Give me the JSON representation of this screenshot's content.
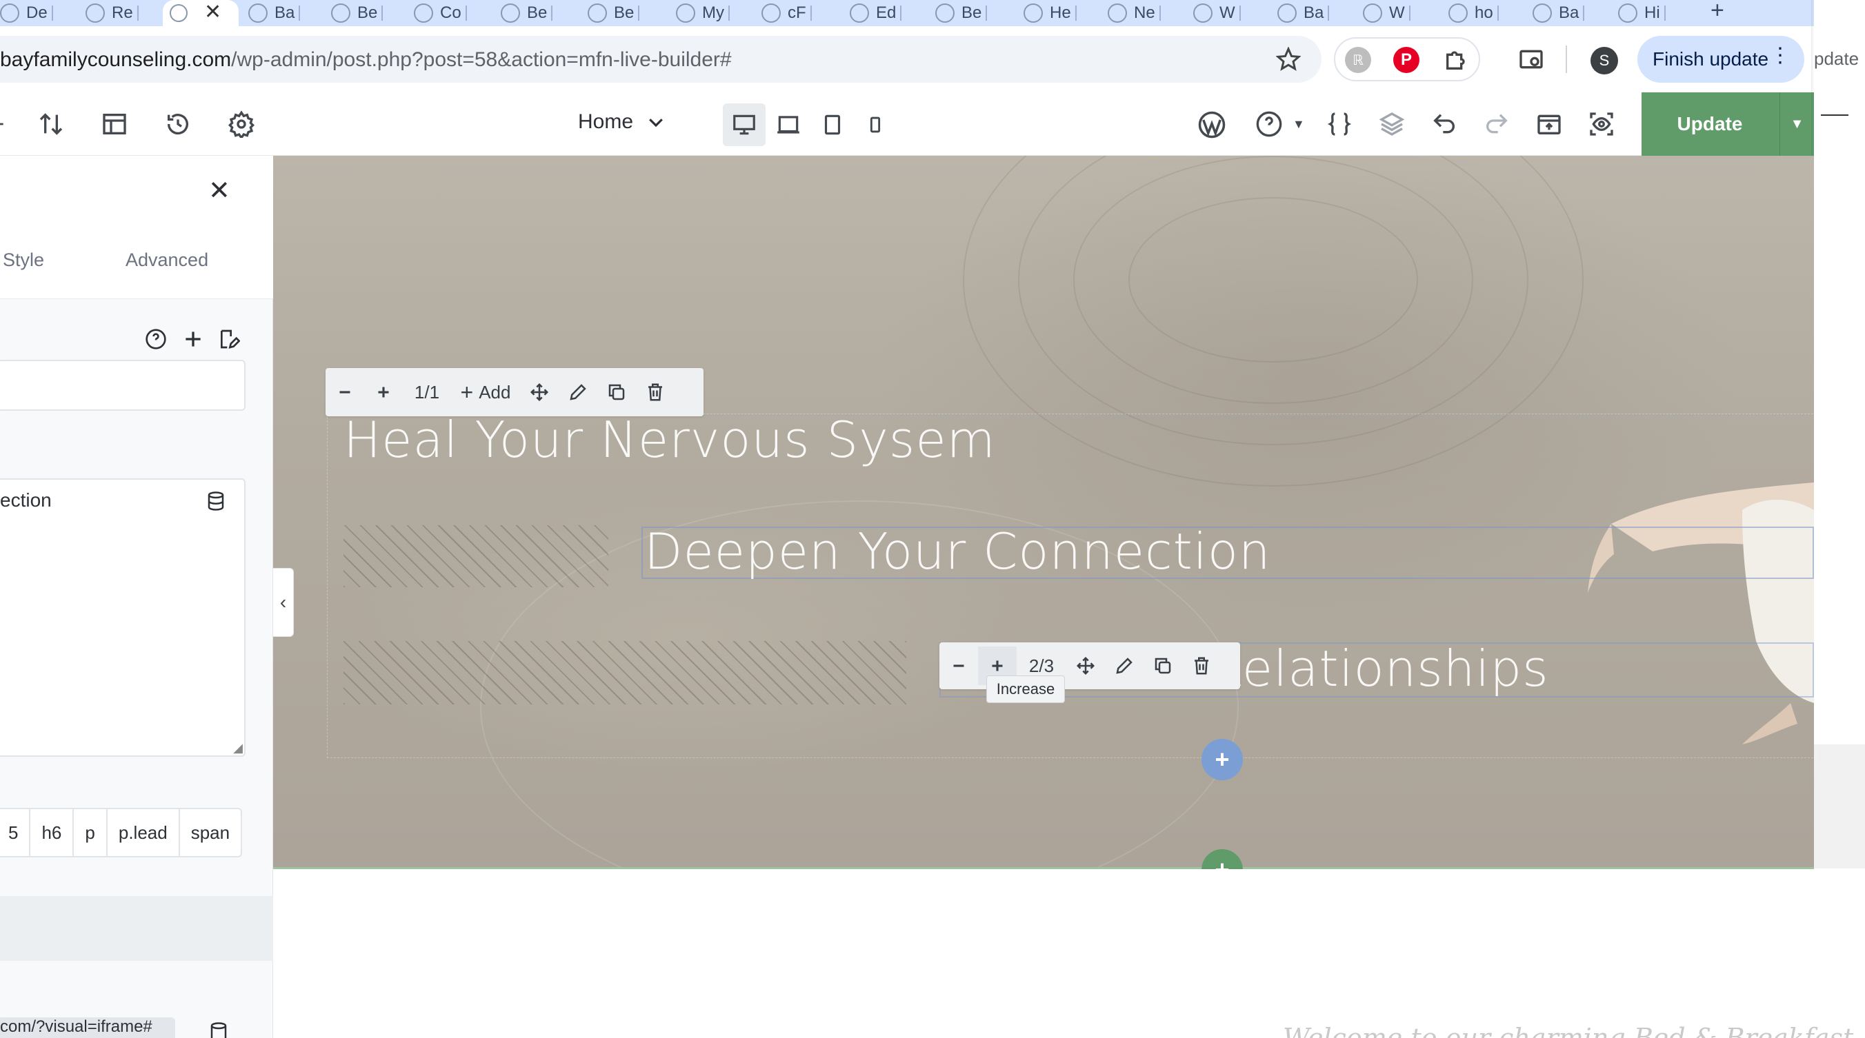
{
  "browser": {
    "tabs": [
      {
        "label": "De"
      },
      {
        "label": "Re"
      },
      {
        "label": ""
      },
      {
        "label": "Ba"
      },
      {
        "label": "Be"
      },
      {
        "label": "Co"
      },
      {
        "label": "Be"
      },
      {
        "label": "Be"
      },
      {
        "label": "My"
      },
      {
        "label": "cF"
      },
      {
        "label": "Ed"
      },
      {
        "label": "Be"
      },
      {
        "label": "He"
      },
      {
        "label": "Ne"
      },
      {
        "label": "W"
      },
      {
        "label": "Ba"
      },
      {
        "label": "W"
      },
      {
        "label": "ho"
      },
      {
        "label": "Ba"
      },
      {
        "label": "Hi"
      }
    ],
    "url_host": "bayfamilycounseling.com",
    "url_path": "/wp-admin/post.php?post=58&action=mfn-live-builder#",
    "profile_initial": "S",
    "finish_update_label": "Finish update",
    "right_window_text": "pdate"
  },
  "builder": {
    "page_select": "Home",
    "update_label": "Update"
  },
  "panel": {
    "tabs": [
      "Style",
      "Advanced"
    ],
    "textarea_value": "ection",
    "tag_buttons": [
      "5",
      "h6",
      "p",
      "p.lead",
      "span"
    ],
    "iframe_url": "com/?visual=iframe#"
  },
  "canvas": {
    "heading1": "Heal Your Nervous Sysem",
    "heading2": "Deepen Your Connection",
    "heading3": "ur Relationships",
    "wrap1": {
      "size": "1/1",
      "add_label": "Add"
    },
    "wrap2": {
      "size": "2/3"
    },
    "tooltip": "Increase",
    "welcome_text": "Welcome to our charming Bed & Breakfast, lo"
  },
  "colors": {
    "update_green": "#5f9c69",
    "add_blue": "#7b9ed4",
    "chrome_tab_strip": "#d3e3fd"
  }
}
